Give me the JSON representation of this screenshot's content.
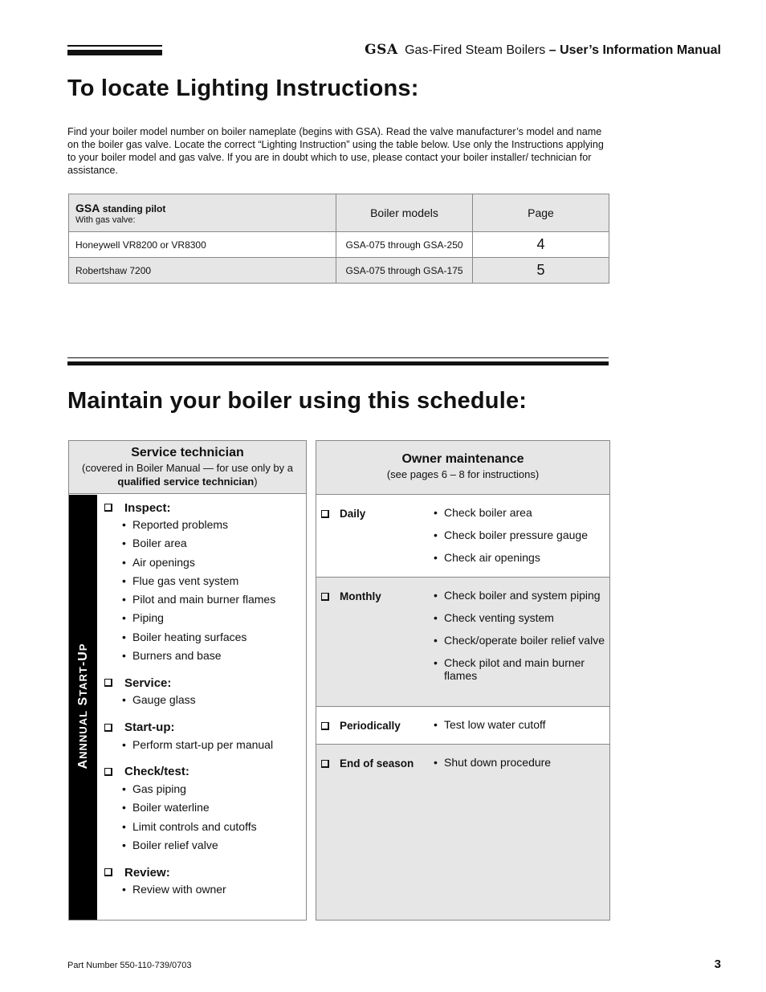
{
  "header": {
    "logo": "GSA",
    "title_regular": "Gas-Fired Steam Boilers",
    "title_sep": " – ",
    "title_bold": "User’s Information Manual"
  },
  "section1": {
    "heading": "To locate Lighting Instructions:",
    "intro": "Find your boiler model number on boiler nameplate (begins with GSA). Read the valve manufacturer’s model and name on the boiler gas valve. Locate the correct “Lighting Instruction” using the table below. Use only the Instructions applying to your boiler model and gas valve. If you are in doubt which to use, please contact your boiler installer/ technician for assistance.",
    "table": {
      "head": {
        "brand": "GSA",
        "type": "standing pilot",
        "sub": "With gas valve:",
        "models": "Boiler models",
        "page": "Page"
      },
      "rows": [
        {
          "valve": "Honeywell VR8200 or VR8300",
          "models": "GSA-075 through GSA-250",
          "page": "4"
        },
        {
          "valve": "Robertshaw 7200",
          "models": "GSA-075 through GSA-175",
          "page": "5"
        }
      ]
    }
  },
  "section2": {
    "heading": "Maintain your boiler using this schedule:",
    "service": {
      "title": "Service technician",
      "sub1": "(covered in Boiler Manual — for use only by a",
      "sub2_bold": "qualified service technician",
      "sub2_end": ")",
      "side_label": "Annnual Start-up",
      "groups": [
        {
          "title": "Inspect:",
          "items": [
            "Reported problems",
            "Boiler area",
            "Air openings",
            "Flue gas vent system",
            "Pilot and main burner flames",
            "Piping",
            "Boiler heating surfaces",
            "Burners and base"
          ]
        },
        {
          "title": "Service:",
          "items": [
            "Gauge glass"
          ]
        },
        {
          "title": "Start-up:",
          "items": [
            "Perform start-up per manual"
          ]
        },
        {
          "title": "Check/test:",
          "items": [
            "Gas piping",
            "Boiler waterline",
            "Limit controls and cutoffs",
            "Boiler relief valve"
          ]
        },
        {
          "title": "Review:",
          "items": [
            "Review with owner"
          ]
        }
      ]
    },
    "owner": {
      "title": "Owner maintenance",
      "sub": "(see pages 6 – 8 for instructions)",
      "rows": [
        {
          "label": "Daily",
          "items": [
            "Check boiler area",
            "Check boiler pressure gauge",
            "Check air openings"
          ]
        },
        {
          "label": "Monthly",
          "items": [
            "Check boiler and system piping",
            "Check venting system",
            "Check/operate boiler relief valve",
            "Check pilot and main burner flames"
          ]
        },
        {
          "label": "Periodically",
          "items": [
            "Test low water cutoff"
          ]
        },
        {
          "label": "End of season",
          "items": [
            "Shut down procedure"
          ]
        }
      ]
    }
  },
  "footer": {
    "part_number": "Part Number 550-110-739/0703",
    "page": "3"
  }
}
